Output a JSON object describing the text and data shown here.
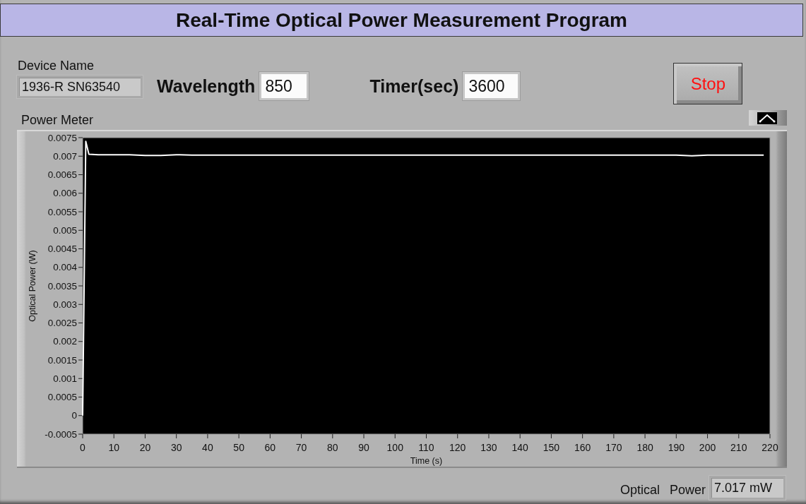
{
  "title": "Real-Time Optical Power Measurement Program",
  "device_name": {
    "label": "Device Name",
    "value": "1936-R SN63540"
  },
  "wavelength": {
    "label": "Wavelength",
    "value": "850"
  },
  "timer": {
    "label": "Timer(sec)",
    "value": "3600"
  },
  "stop_button": {
    "label": "Stop"
  },
  "power_meter": {
    "label": "Power Meter",
    "chart_data": [
      {
        "type": "line",
        "xlabel": "Time (s)",
        "ylabel": "Optical Power (W)",
        "color": "#ffffff",
        "xlim": [
          0,
          220
        ],
        "ylim": [
          -0.0005,
          0.0075
        ],
        "xticks": [
          0,
          10,
          20,
          30,
          40,
          50,
          60,
          70,
          80,
          90,
          100,
          110,
          120,
          130,
          140,
          150,
          160,
          170,
          180,
          190,
          200,
          210,
          220
        ],
        "yticks": [
          -0.0005,
          0,
          0.0005,
          0.001,
          0.0015,
          0.002,
          0.0025,
          0.003,
          0.0035,
          0.004,
          0.0045,
          0.005,
          0.0055,
          0.006,
          0.0065,
          0.007,
          0.0075
        ],
        "x": [
          0,
          1,
          2,
          5,
          10,
          15,
          20,
          25,
          30,
          35,
          40,
          50,
          60,
          70,
          80,
          90,
          100,
          110,
          120,
          130,
          140,
          150,
          160,
          170,
          180,
          190,
          195,
          200,
          210,
          218
        ],
        "values": [
          0,
          0.0074,
          0.00705,
          0.00704,
          0.00704,
          0.00704,
          0.00702,
          0.00702,
          0.00704,
          0.00703,
          0.00703,
          0.00703,
          0.00703,
          0.00703,
          0.00703,
          0.00703,
          0.00703,
          0.00703,
          0.00703,
          0.00703,
          0.00703,
          0.00703,
          0.00703,
          0.00703,
          0.00703,
          0.00703,
          0.00701,
          0.00703,
          0.00703,
          0.00703
        ]
      }
    ]
  },
  "optical_power": {
    "label": "Optical Power",
    "value": "7.017 mW"
  }
}
